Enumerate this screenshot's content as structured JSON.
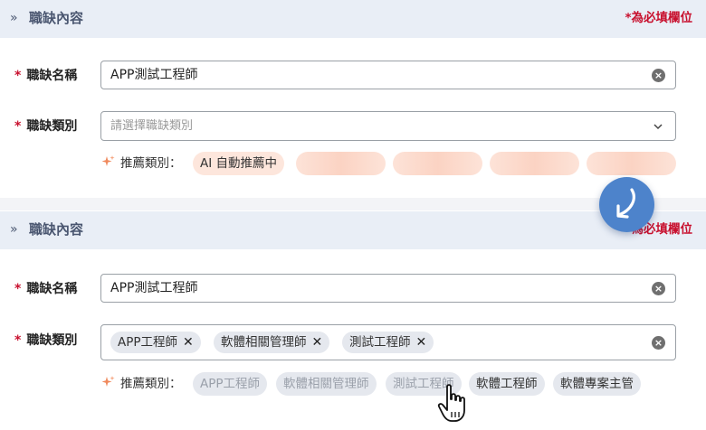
{
  "section1": {
    "chevron": "»",
    "title": "職缺內容",
    "required_note": "*為必填欄位",
    "job_name": {
      "label": "職缺名稱",
      "value": "APP測試工程師"
    },
    "job_category": {
      "label": "職缺類別",
      "placeholder": "請選擇職缺類別"
    },
    "recommend": {
      "label": "推薦類別：",
      "ai_status": "AI 自動推薦中"
    }
  },
  "section2": {
    "chevron": "»",
    "title": "職缺內容",
    "required_note": "為必填欄位",
    "job_name": {
      "label": "職缺名稱",
      "value": "APP測試工程師"
    },
    "job_category": {
      "label": "職缺類別",
      "selected": [
        "APP工程師",
        "軟體相關管理師",
        "測試工程師"
      ]
    },
    "recommend": {
      "label": "推薦類別：",
      "items": [
        "APP工程師",
        "軟體相關管理師",
        "測試工程師",
        "軟體工程師",
        "軟體專案主管"
      ]
    }
  },
  "icons": {
    "sparkle": "sparkle-icon",
    "clear": "clear-icon",
    "chevron_down": "chevron-down-icon",
    "remove": "close-icon",
    "arrow": "curved-arrow-icon",
    "cursor": "hand-pointer-icon"
  },
  "colors": {
    "header_bg": "#e9eef6",
    "header_text": "#4a5670",
    "required": "#c8102e",
    "ai_pill": "#fde6dc",
    "chip_bg": "#e5e8ee",
    "fab": "#4d83cb",
    "sparkle": "#f08a5d"
  }
}
